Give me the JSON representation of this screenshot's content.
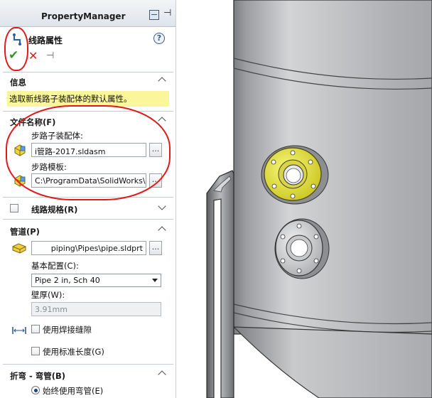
{
  "panel": {
    "title": "PropertyManager",
    "feature_name": "线路属性",
    "help_glyph": "?",
    "ok_glyph": "✔",
    "cancel_glyph": "✕",
    "pin_glyph": "⊣"
  },
  "info": {
    "title": "信息",
    "message": "选取新线路子装配体的默认属性。"
  },
  "file_name_group": {
    "title": "文件名称(F)",
    "route_assembly_label": "步路子装配体:",
    "route_assembly_value": "i管路-2017.sldasm",
    "route_template_label": "步路模板:",
    "route_template_value": "C:\\ProgramData\\SolidWorks\\SO",
    "browse_label": "..."
  },
  "route_spec_group": {
    "title": "线路规格(R)"
  },
  "pipe_group": {
    "title": "管道(P)",
    "pipe_file_value": "piping\\Pipes\\pipe.sldprt",
    "browse_label": "...",
    "basic_config_label": "基本配置(C):",
    "basic_config_value": "Pipe 2 in, Sch 40",
    "wall_thickness_label": "壁厚(W):",
    "wall_thickness_value": "3.91mm",
    "use_weld_gap_label": "使用焊接缝隙",
    "use_standard_length_label": "使用标准长度(G)"
  },
  "bend_group": {
    "title": "折弯 - 弯管(B)",
    "always_use_elbow_label": "始终使用弯管(E)"
  },
  "colors": {
    "annotation_red": "#e01a1a",
    "info_yellow": "#fbf69a",
    "flange_yellow": "#ecec2a",
    "ok_green": "#2f9a25",
    "cancel_red": "#cc2424"
  }
}
